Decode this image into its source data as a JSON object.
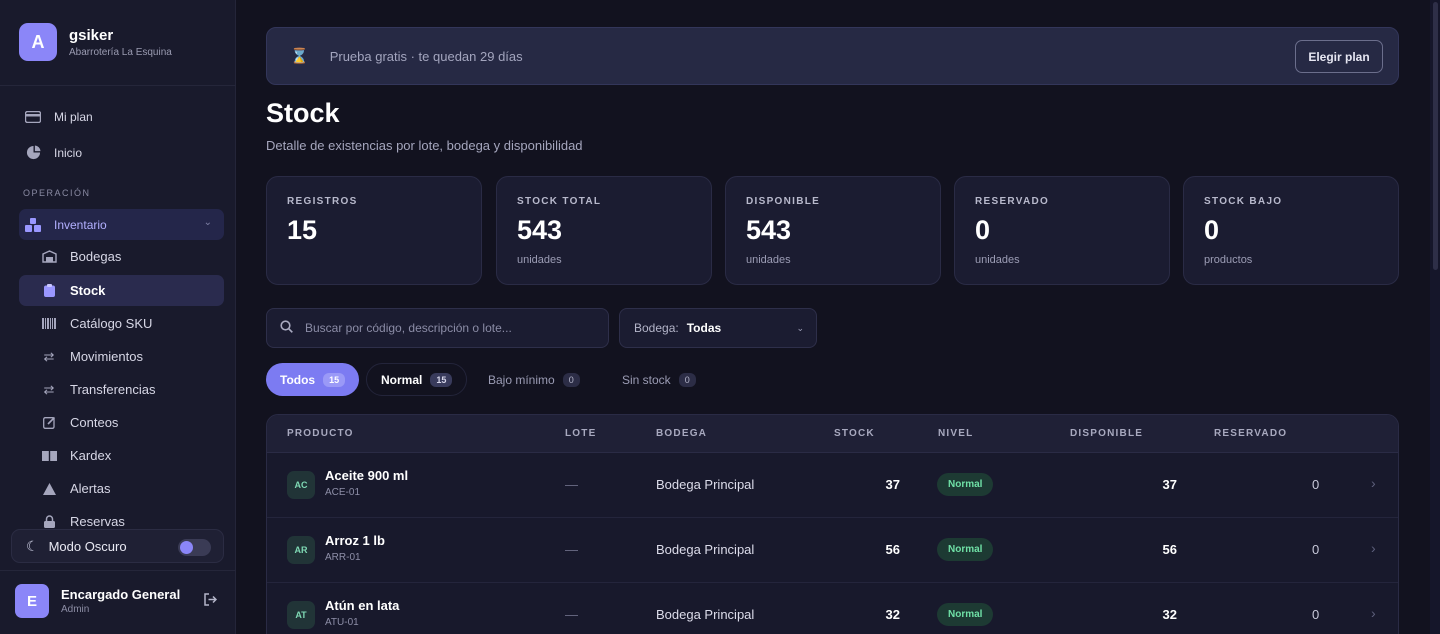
{
  "brand": {
    "initial": "A",
    "name": "gsiker",
    "subtitle": "Abarrotería La Esquina"
  },
  "nav": {
    "top": [
      {
        "label": "Mi plan",
        "icon": "credit-card-icon"
      },
      {
        "label": "Inicio",
        "icon": "pie-chart-icon"
      }
    ],
    "section": "OPERACIÓN",
    "inventory": {
      "label": "Inventario",
      "icon": "boxes-icon"
    },
    "sub": [
      {
        "label": "Bodegas",
        "icon": "warehouse-icon"
      },
      {
        "label": "Stock",
        "icon": "clipboard-icon"
      },
      {
        "label": "Catálogo SKU",
        "icon": "barcode-icon"
      },
      {
        "label": "Movimientos",
        "icon": "arrows-icon"
      },
      {
        "label": "Transferencias",
        "icon": "arrows-icon"
      },
      {
        "label": "Conteos",
        "icon": "edit-icon"
      },
      {
        "label": "Kardex",
        "icon": "book-icon"
      },
      {
        "label": "Alertas",
        "icon": "alert-icon"
      },
      {
        "label": "Reservas",
        "icon": "lock-icon"
      }
    ]
  },
  "dark_mode": {
    "label": "Modo Oscuro",
    "enabled": true
  },
  "user": {
    "initial": "E",
    "name": "Encargado General",
    "role": "Admin"
  },
  "trial": {
    "text": "Prueba gratis · te quedan 29 días",
    "button": "Elegir plan"
  },
  "page": {
    "title": "Stock",
    "subtitle": "Detalle de existencias por lote, bodega y disponibilidad"
  },
  "cards": [
    {
      "label": "REGISTROS",
      "value": "15",
      "unit": ""
    },
    {
      "label": "STOCK TOTAL",
      "value": "543",
      "unit": "unidades"
    },
    {
      "label": "DISPONIBLE",
      "value": "543",
      "unit": "unidades"
    },
    {
      "label": "RESERVADO",
      "value": "0",
      "unit": "unidades"
    },
    {
      "label": "STOCK BAJO",
      "value": "0",
      "unit": "productos"
    }
  ],
  "search": {
    "placeholder": "Buscar por código, descripción o lote..."
  },
  "bodega_filter": {
    "label": "Bodega:",
    "value": "Todas"
  },
  "filters": [
    {
      "label": "Todos",
      "count": "15"
    },
    {
      "label": "Normal",
      "count": "15"
    },
    {
      "label": "Bajo mínimo",
      "count": "0"
    },
    {
      "label": "Sin stock",
      "count": "0"
    }
  ],
  "table": {
    "headers": [
      "PRODUCTO",
      "LOTE",
      "BODEGA",
      "STOCK",
      "NIVEL",
      "DISPONIBLE",
      "RESERVADO"
    ],
    "rows": [
      {
        "badge": "AC",
        "name": "Aceite 900 ml",
        "sku": "ACE-01",
        "lote": "—",
        "bodega": "Bodega Principal",
        "stock": "37",
        "nivel": "Normal",
        "disponible": "37",
        "reservado": "0"
      },
      {
        "badge": "AR",
        "name": "Arroz 1 lb",
        "sku": "ARR-01",
        "lote": "—",
        "bodega": "Bodega Principal",
        "stock": "56",
        "nivel": "Normal",
        "disponible": "56",
        "reservado": "0"
      },
      {
        "badge": "AT",
        "name": "Atún en lata",
        "sku": "ATU-01",
        "lote": "—",
        "bodega": "Bodega Principal",
        "stock": "32",
        "nivel": "Normal",
        "disponible": "32",
        "reservado": "0"
      }
    ]
  },
  "colors": {
    "accent": "#7c7bf2",
    "background": "#12121f",
    "sidebar": "#191a2c",
    "level_normal": "#6fe0a6"
  }
}
